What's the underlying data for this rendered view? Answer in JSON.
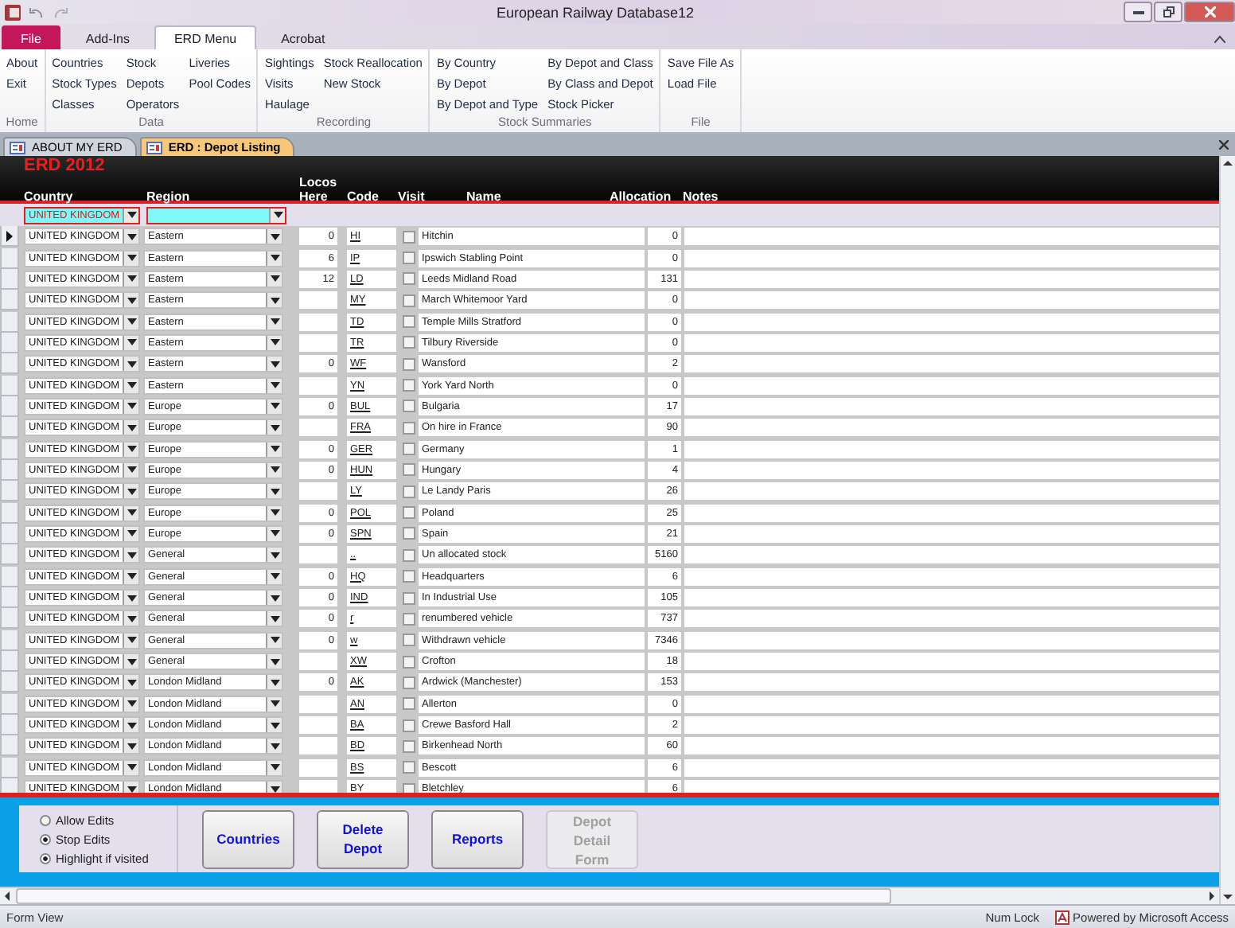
{
  "window": {
    "title": "European Railway Database12"
  },
  "ribbon_tabs": [
    {
      "label": "File",
      "kind": "file",
      "selected": false
    },
    {
      "label": "Add-Ins",
      "kind": "tab",
      "selected": false
    },
    {
      "label": "ERD Menu",
      "kind": "tab",
      "selected": true
    },
    {
      "label": "Acrobat",
      "kind": "tab",
      "selected": false
    }
  ],
  "ribbon_groups": [
    {
      "label": "Home",
      "columns": [
        [
          "About",
          "Exit"
        ]
      ]
    },
    {
      "label": "Data",
      "columns": [
        [
          "Countries",
          "Stock Types",
          "Classes"
        ],
        [
          "Stock",
          "Depots",
          "Operators"
        ],
        [
          "Liveries",
          "Pool Codes"
        ]
      ]
    },
    {
      "label": "Recording",
      "columns": [
        [
          "Sightings",
          "Visits",
          "Haulage"
        ],
        [
          "Stock Reallocation",
          "New Stock"
        ]
      ]
    },
    {
      "label": "Stock Summaries",
      "columns": [
        [
          "By Country",
          "By Depot",
          "By Depot and Type"
        ],
        [
          "By Depot and Class",
          "By Class and Depot",
          "Stock Picker"
        ]
      ]
    },
    {
      "label": "File",
      "columns": [
        [
          "Save File As",
          "Load File"
        ]
      ]
    }
  ],
  "doc_tabs": [
    {
      "label": "ABOUT MY ERD",
      "selected": false
    },
    {
      "label": "ERD : Depot Listing",
      "selected": true
    }
  ],
  "form": {
    "title": "ERD 2012",
    "columns": [
      "Country",
      "Region",
      "Locos Here",
      "Code",
      "Visit",
      "Name",
      "Allocation",
      "Notes"
    ],
    "filter": {
      "country": "UNITED KINGDOM"
    },
    "rows": [
      {
        "country": "UNITED KINGDOM",
        "region": "Eastern",
        "locos": "0",
        "code": "HI",
        "visit": false,
        "name": "Hitchin",
        "allocation": "0",
        "selected": true
      },
      {
        "country": "UNITED KINGDOM",
        "region": "Eastern",
        "locos": "6",
        "code": "IP",
        "visit": false,
        "name": "Ipswich Stabling Point",
        "allocation": "0",
        "selected": false
      },
      {
        "country": "UNITED KINGDOM",
        "region": "Eastern",
        "locos": "12",
        "code": "LD",
        "visit": false,
        "name": "Leeds Midland Road",
        "allocation": "131",
        "selected": false
      },
      {
        "country": "UNITED KINGDOM",
        "region": "Eastern",
        "locos": "",
        "code": "MY",
        "visit": false,
        "name": "March Whitemoor Yard",
        "allocation": "0",
        "selected": false
      },
      {
        "country": "UNITED KINGDOM",
        "region": "Eastern",
        "locos": "",
        "code": "TD",
        "visit": false,
        "name": "Temple Mills Stratford",
        "allocation": "0",
        "selected": false
      },
      {
        "country": "UNITED KINGDOM",
        "region": "Eastern",
        "locos": "",
        "code": "TR",
        "visit": false,
        "name": "Tilbury Riverside",
        "allocation": "0",
        "selected": false
      },
      {
        "country": "UNITED KINGDOM",
        "region": "Eastern",
        "locos": "0",
        "code": "WF",
        "visit": false,
        "name": "Wansford",
        "allocation": "2",
        "selected": false
      },
      {
        "country": "UNITED KINGDOM",
        "region": "Eastern",
        "locos": "",
        "code": "YN",
        "visit": false,
        "name": "York Yard North",
        "allocation": "0",
        "selected": false
      },
      {
        "country": "UNITED KINGDOM",
        "region": "Europe",
        "locos": "0",
        "code": "BUL",
        "visit": false,
        "name": "Bulgaria",
        "allocation": "17",
        "selected": false
      },
      {
        "country": "UNITED KINGDOM",
        "region": "Europe",
        "locos": "",
        "code": "FRA",
        "visit": false,
        "name": "On hire in France",
        "allocation": "90",
        "selected": false
      },
      {
        "country": "UNITED KINGDOM",
        "region": "Europe",
        "locos": "0",
        "code": "GER",
        "visit": false,
        "name": "Germany",
        "allocation": "1",
        "selected": false
      },
      {
        "country": "UNITED KINGDOM",
        "region": "Europe",
        "locos": "0",
        "code": "HUN",
        "visit": false,
        "name": "Hungary",
        "allocation": "4",
        "selected": false
      },
      {
        "country": "UNITED KINGDOM",
        "region": "Europe",
        "locos": "",
        "code": "LY",
        "visit": false,
        "name": "Le Landy Paris",
        "allocation": "26",
        "selected": false
      },
      {
        "country": "UNITED KINGDOM",
        "region": "Europe",
        "locos": "0",
        "code": "POL",
        "visit": false,
        "name": "Poland",
        "allocation": "25",
        "selected": false
      },
      {
        "country": "UNITED KINGDOM",
        "region": "Europe",
        "locos": "0",
        "code": "SPN",
        "visit": false,
        "name": "Spain",
        "allocation": "21",
        "selected": false
      },
      {
        "country": "UNITED KINGDOM",
        "region": "General",
        "locos": "",
        "code": "..",
        "visit": false,
        "name": "Un allocated stock",
        "allocation": "5160",
        "selected": false
      },
      {
        "country": "UNITED KINGDOM",
        "region": "General",
        "locos": "0",
        "code": "HQ",
        "visit": false,
        "name": "Headquarters",
        "allocation": "6",
        "selected": false
      },
      {
        "country": "UNITED KINGDOM",
        "region": "General",
        "locos": "0",
        "code": "IND",
        "visit": false,
        "name": "In Industrial Use",
        "allocation": "105",
        "selected": false
      },
      {
        "country": "UNITED KINGDOM",
        "region": "General",
        "locos": "0",
        "code": "r",
        "visit": false,
        "name": "renumbered vehicle",
        "allocation": "737",
        "selected": false
      },
      {
        "country": "UNITED KINGDOM",
        "region": "General",
        "locos": "0",
        "code": "w",
        "visit": false,
        "name": "Withdrawn vehicle",
        "allocation": "7346",
        "selected": false
      },
      {
        "country": "UNITED KINGDOM",
        "region": "General",
        "locos": "",
        "code": "XW",
        "visit": false,
        "name": "Crofton",
        "allocation": "18",
        "selected": false
      },
      {
        "country": "UNITED KINGDOM",
        "region": "London Midland",
        "locos": "0",
        "code": "AK",
        "visit": false,
        "name": "Ardwick (Manchester)",
        "allocation": "153",
        "selected": false
      },
      {
        "country": "UNITED KINGDOM",
        "region": "London Midland",
        "locos": "",
        "code": "AN",
        "visit": false,
        "name": "Allerton",
        "allocation": "0",
        "selected": false
      },
      {
        "country": "UNITED KINGDOM",
        "region": "London Midland",
        "locos": "",
        "code": "BA",
        "visit": false,
        "name": "Crewe Basford Hall",
        "allocation": "2",
        "selected": false
      },
      {
        "country": "UNITED KINGDOM",
        "region": "London Midland",
        "locos": "",
        "code": "BD",
        "visit": false,
        "name": "Birkenhead North",
        "allocation": "60",
        "selected": false
      },
      {
        "country": "UNITED KINGDOM",
        "region": "London Midland",
        "locos": "",
        "code": "BS",
        "visit": false,
        "name": "Bescott",
        "allocation": "6",
        "selected": false
      },
      {
        "country": "UNITED KINGDOM",
        "region": "London Midland",
        "locos": "",
        "code": "BY",
        "visit": false,
        "name": "Bletchley",
        "allocation": "6",
        "selected": false
      }
    ],
    "options": [
      {
        "label": "Allow Edits",
        "selected": false
      },
      {
        "label": "Stop Edits",
        "selected": true
      },
      {
        "label": "Highlight if visited",
        "selected": true
      }
    ],
    "buttons": [
      {
        "label": "Countries",
        "disabled": false
      },
      {
        "label": "Delete Depot",
        "disabled": false
      },
      {
        "label": "Reports",
        "disabled": false
      },
      {
        "label": "Depot Detail Form",
        "disabled": true
      }
    ]
  },
  "status_bar": {
    "view": "Form View",
    "num_lock": "Num Lock",
    "powered_by": "Powered by Microsoft Access"
  }
}
